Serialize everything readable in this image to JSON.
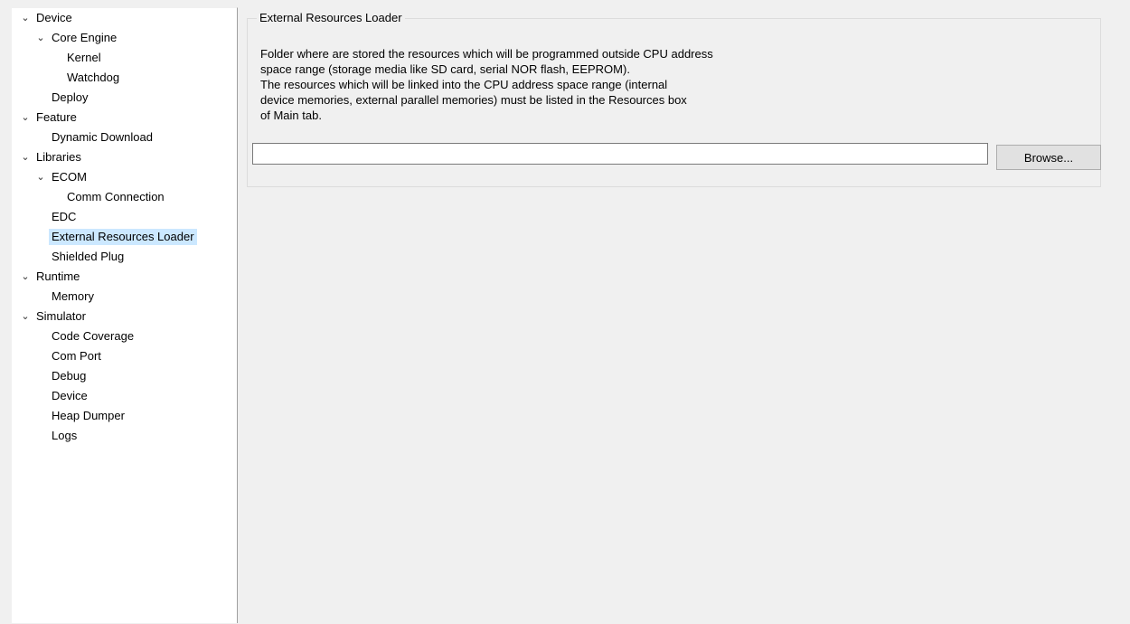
{
  "tree": {
    "items": [
      {
        "label": "Device",
        "depth": 0,
        "expanded": true
      },
      {
        "label": "Core Engine",
        "depth": 1,
        "expanded": true
      },
      {
        "label": "Kernel",
        "depth": 2
      },
      {
        "label": "Watchdog",
        "depth": 2
      },
      {
        "label": "Deploy",
        "depth": 1
      },
      {
        "label": "Feature",
        "depth": 0,
        "expanded": true
      },
      {
        "label": "Dynamic Download",
        "depth": 1
      },
      {
        "label": "Libraries",
        "depth": 0,
        "expanded": true
      },
      {
        "label": "ECOM",
        "depth": 1,
        "expanded": true
      },
      {
        "label": "Comm Connection",
        "depth": 2
      },
      {
        "label": "EDC",
        "depth": 1
      },
      {
        "label": "External Resources Loader",
        "depth": 1,
        "selected": true
      },
      {
        "label": "Shielded Plug",
        "depth": 1
      },
      {
        "label": "Runtime",
        "depth": 0,
        "expanded": true
      },
      {
        "label": "Memory",
        "depth": 1
      },
      {
        "label": "Simulator",
        "depth": 0,
        "expanded": true
      },
      {
        "label": "Code Coverage",
        "depth": 1
      },
      {
        "label": "Com Port",
        "depth": 1
      },
      {
        "label": "Debug",
        "depth": 1
      },
      {
        "label": "Device",
        "depth": 1
      },
      {
        "label": "Heap Dumper",
        "depth": 1
      },
      {
        "label": "Logs",
        "depth": 1
      }
    ]
  },
  "group": {
    "title": "External Resources Loader",
    "description_lines": [
      "Folder where are stored the resources which will be programmed outside CPU address",
      "space range (storage media like SD card, serial NOR flash, EEPROM).",
      "The resources which will be linked into the CPU address space range (internal",
      "device memories, external parallel memories) must be listed in the Resources box",
      "of Main tab."
    ],
    "path_value": "",
    "browse_label": "Browse..."
  },
  "colors": {
    "selection": "#cce8ff",
    "panel_bg": "#f0f0f0",
    "tree_bg": "#ffffff"
  }
}
